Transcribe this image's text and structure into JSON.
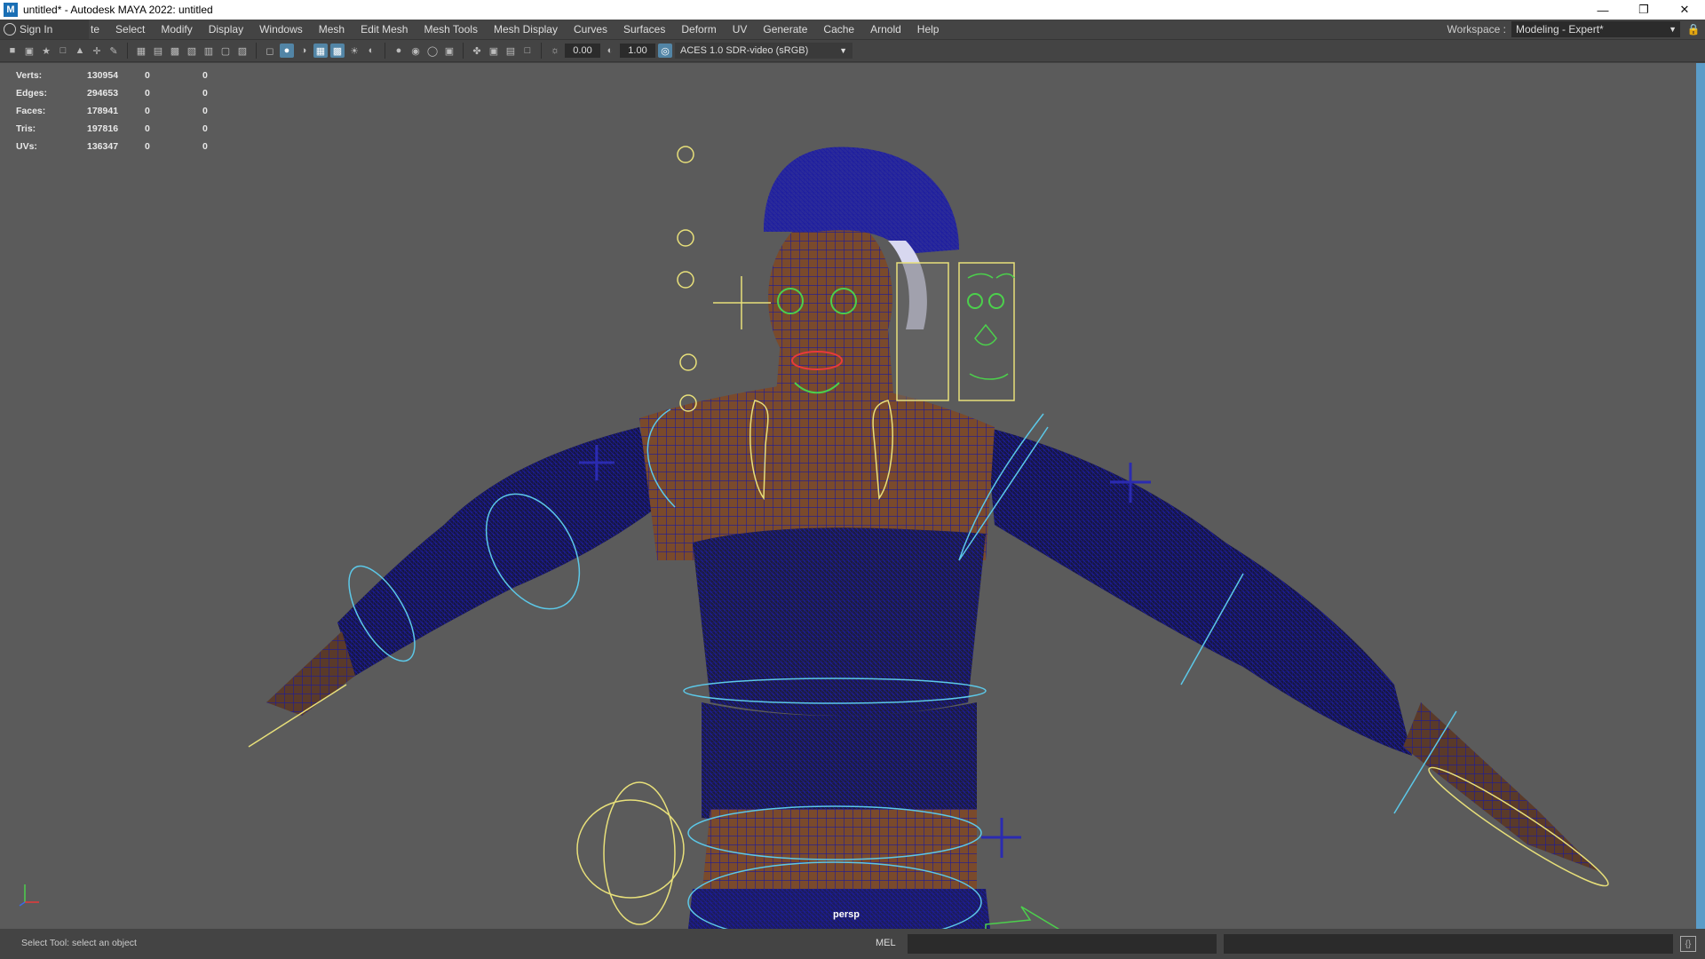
{
  "window": {
    "title": "untitled* - Autodesk MAYA 2022: untitled",
    "app_icon": "M",
    "controls": [
      "minimize-icon",
      "restore-icon",
      "close-icon"
    ]
  },
  "menubar": {
    "signin_label": "Sign In",
    "items": [
      "te",
      "Select",
      "Modify",
      "Display",
      "Windows",
      "Mesh",
      "Edit Mesh",
      "Mesh Tools",
      "Mesh Display",
      "Curves",
      "Surfaces",
      "Deform",
      "UV",
      "Generate",
      "Cache",
      "Arnold",
      "Help"
    ],
    "workspace_label": "Workspace :",
    "workspace_value": "Modeling - Expert*"
  },
  "toolbar": {
    "exposure": "0.00",
    "gamma": "1.00",
    "colorspace": "ACES 1.0 SDR-video (sRGB)"
  },
  "hud": {
    "rows": [
      {
        "label": "Verts:",
        "v1": "130954",
        "v2": "0",
        "v3": "0"
      },
      {
        "label": "Edges:",
        "v1": "294653",
        "v2": "0",
        "v3": "0"
      },
      {
        "label": "Faces:",
        "v1": "178941",
        "v2": "0",
        "v3": "0"
      },
      {
        "label": "Tris:",
        "v1": "197816",
        "v2": "0",
        "v3": "0"
      },
      {
        "label": "UVs:",
        "v1": "136347",
        "v2": "0",
        "v3": "0"
      }
    ]
  },
  "viewport": {
    "camera_label": "persp",
    "wire_color": "#1a1a9e",
    "skin_color": "#7a4a2c",
    "ctrl_yellow": "#e8e07a",
    "ctrl_cyan": "#5cc8e8"
  },
  "statusbar": {
    "help_text": "Select Tool: select an object",
    "mel_label": "MEL"
  }
}
